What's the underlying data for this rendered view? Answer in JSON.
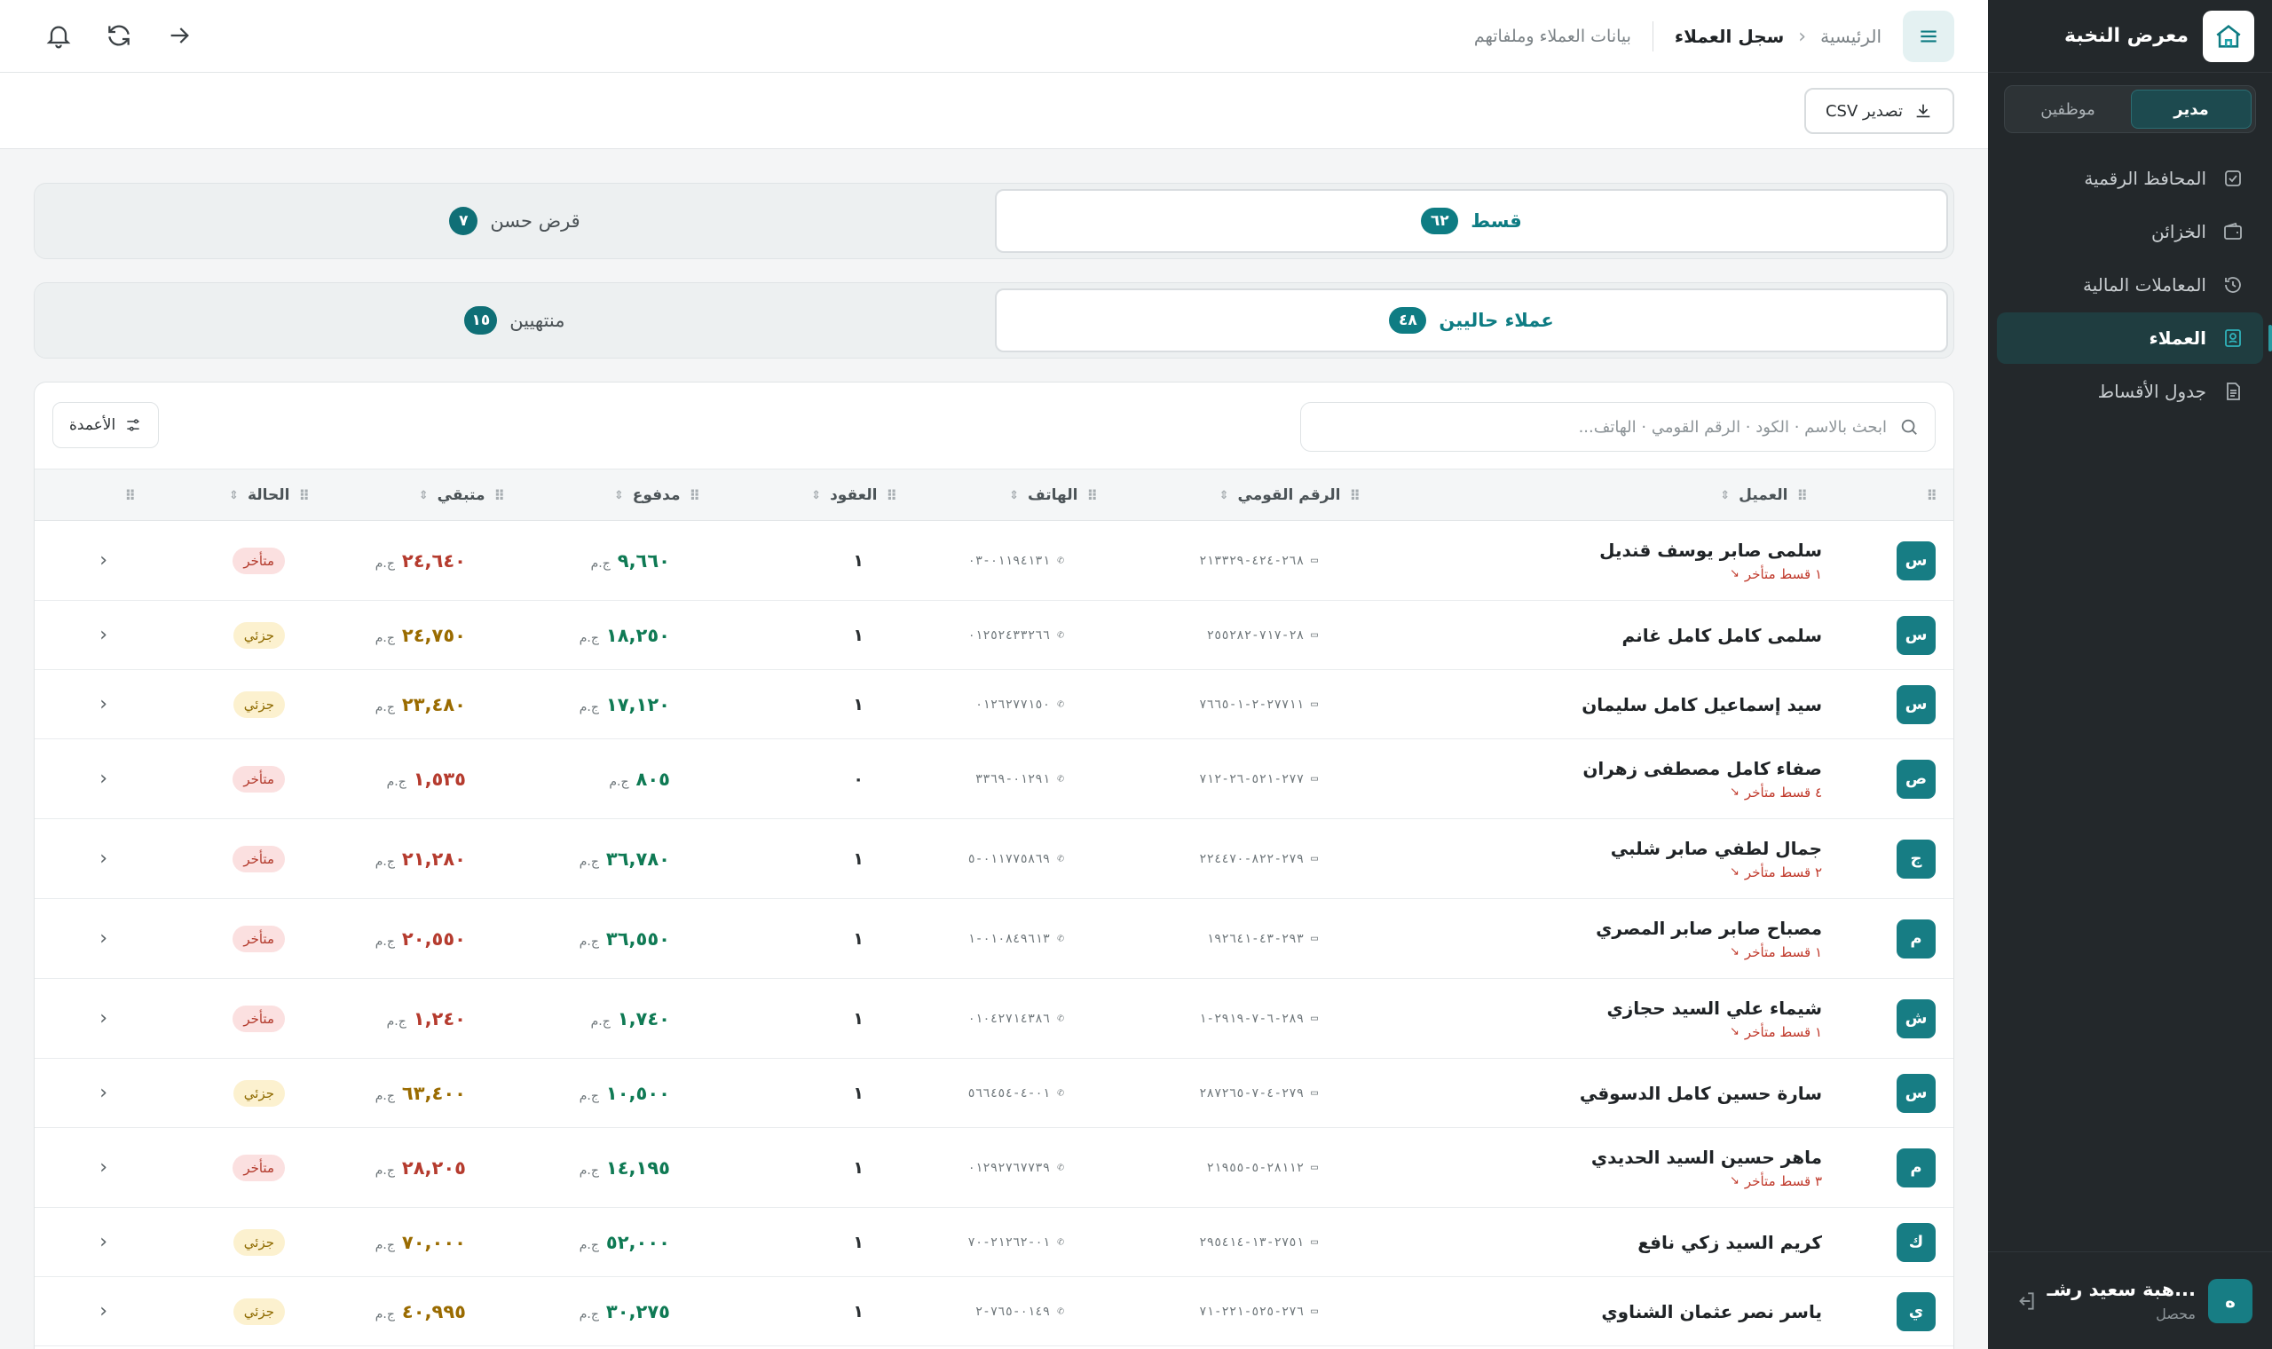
{
  "sidebar": {
    "brand": "معرض النخبة",
    "roles": [
      "مدير",
      "موظفين"
    ],
    "active_role_index": 0,
    "items": [
      {
        "label": "المحافظ الرقمية",
        "icon": "check-square-icon",
        "active": false
      },
      {
        "label": "الخزائن",
        "icon": "wallet-icon",
        "active": false
      },
      {
        "label": "المعاملات المالية",
        "icon": "history-icon",
        "active": false
      },
      {
        "label": "العملاء",
        "icon": "id-card-icon",
        "active": true
      },
      {
        "label": "جدول الأقساط",
        "icon": "document-icon",
        "active": false
      }
    ],
    "user": {
      "name": "هبة سعيد رشـ...",
      "role": "محصل",
      "initial": "ه"
    }
  },
  "topbar": {
    "home": "الرئيسية",
    "current": "سجل العملاء",
    "description": "بيانات العملاء وملفاتهم"
  },
  "actions": {
    "export_label": "تصدير CSV"
  },
  "tabs_type": [
    {
      "label": "قسط",
      "count": "٦٢",
      "active": true
    },
    {
      "label": "قرض حسن",
      "count": "٧",
      "active": false
    }
  ],
  "tabs_status": [
    {
      "label": "عملاء حاليين",
      "count": "٤٨",
      "active": true
    },
    {
      "label": "منتهيين",
      "count": "١٥",
      "active": false
    }
  ],
  "search": {
    "placeholder": "ابحث بالاسم · الكود · الرقم القومي · الهاتف..."
  },
  "columns_button": "الأعمدة",
  "table": {
    "headers": {
      "client": "العميل",
      "national_id": "الرقم القومي",
      "phone": "الهاتف",
      "contracts": "العقود",
      "paid": "مدفوع",
      "remaining": "متبقي",
      "status": "الحالة"
    },
    "currency": "ج.م",
    "rows": [
      {
        "initial": "س",
        "name": "سلمى صابر يوسف قنديل",
        "late": "١ قسط متأخر",
        "nid": "٢٦٨-٤٢٤-٢١٣٣٢٩",
        "phone": "٠١١٩٤١٣١-٠٣",
        "contracts": "١",
        "paid": "٩,٦٦٠",
        "remaining": "٢٤,٦٤٠",
        "status": "متأخر",
        "status_kind": "late"
      },
      {
        "initial": "س",
        "name": "سلمى كامل كامل غانم",
        "late": "",
        "nid": "٢٨-٧١٧-٢٥٥٢٨٢",
        "phone": "٠١٢٥٢٤٣٣٢٦٦",
        "contracts": "١",
        "paid": "١٨,٢٥٠",
        "remaining": "٢٤,٧٥٠",
        "status": "جزئي",
        "status_kind": "partial"
      },
      {
        "initial": "س",
        "name": "سيد إسماعيل كامل سليمان",
        "late": "",
        "nid": "٢٧٧١١-٢-١-٧٦٦٥",
        "phone": "٠١٢٦٢٧٧١٥٠",
        "contracts": "١",
        "paid": "١٧,١٢٠",
        "remaining": "٢٣,٤٨٠",
        "status": "جزئي",
        "status_kind": "partial"
      },
      {
        "initial": "ص",
        "name": "صفاء كامل مصطفى زهران",
        "late": "٤ قسط متأخر",
        "nid": "٢٧٧-٥٢١-٢٦-٧١٢",
        "phone": "٠١٢٩١-٣٣٦٩",
        "contracts": "٠",
        "paid": "٨٠٥",
        "remaining": "١,٥٣٥",
        "status": "متأخر",
        "status_kind": "late"
      },
      {
        "initial": "ج",
        "name": "جمال لطفي صابر شلبي",
        "late": "٢ قسط متأخر",
        "nid": "٢٧٩-٨٢٢-٢٢٤٤٧٠",
        "phone": "٠١١٧٧٥٨٦٩-٥",
        "contracts": "١",
        "paid": "٣٦,٧٨٠",
        "remaining": "٢١,٢٨٠",
        "status": "متأخر",
        "status_kind": "late"
      },
      {
        "initial": "م",
        "name": "مصباح صابر صابر المصري",
        "late": "١ قسط متأخر",
        "nid": "٢٩٣-٤٣-١٩٢٦٤١",
        "phone": "٠١٠٨٤٩٦١٣-١",
        "contracts": "١",
        "paid": "٣٦,٥٥٠",
        "remaining": "٢٠,٥٥٠",
        "status": "متأخر",
        "status_kind": "late"
      },
      {
        "initial": "ش",
        "name": "شيماء علي السيد حجازي",
        "late": "١ قسط متأخر",
        "nid": "٢٨٩-٦-٧-٢٩١٩-١",
        "phone": "٠١٠٤٢٧١٤٣٨٦",
        "contracts": "١",
        "paid": "١,٧٤٠",
        "remaining": "١,٢٤٠",
        "status": "متأخر",
        "status_kind": "late"
      },
      {
        "initial": "س",
        "name": "سارة حسين كامل الدسوقي",
        "late": "",
        "nid": "٢٧٩-٤-٧-٢٨٧٢٦٥",
        "phone": "٠١-٤-٥٦٦٤٥٤",
        "contracts": "١",
        "paid": "١٠,٥٠٠",
        "remaining": "٦٣,٤٠٠",
        "status": "جزئي",
        "status_kind": "partial"
      },
      {
        "initial": "م",
        "name": "ماهر حسين السيد الحديدي",
        "late": "٣ قسط متأخر",
        "nid": "٢٨١١٢-٥-٢١٩٥٥",
        "phone": "٠١٢٩٢٧٦٧٧٣٩",
        "contracts": "١",
        "paid": "١٤,١٩٥",
        "remaining": "٢٨,٢٠٥",
        "status": "متأخر",
        "status_kind": "late"
      },
      {
        "initial": "ك",
        "name": "كريم السيد زكي نافع",
        "late": "",
        "nid": "٢٧٥١-١٣-٢٩٥٤١٤",
        "phone": "٠١-٢١٢٦٢-٧٠",
        "contracts": "١",
        "paid": "٥٢,٠٠٠",
        "remaining": "٧٠,٠٠٠",
        "status": "جزئي",
        "status_kind": "partial"
      },
      {
        "initial": "ي",
        "name": "ياسر نصر عثمان الشناوي",
        "late": "",
        "nid": "٢٧٦-٥٢٥-٢٢١-٧١",
        "phone": "٠١٤٩-٧٦٥-٢",
        "contracts": "١",
        "paid": "٣٠,٢٧٥",
        "remaining": "٤٠,٩٩٥",
        "status": "جزئي",
        "status_kind": "partial"
      }
    ]
  },
  "colors": {
    "accent": "#0e7c83",
    "sidebar_bg": "#23282b",
    "late": "#b53b2e",
    "paid": "#0f7a54"
  }
}
